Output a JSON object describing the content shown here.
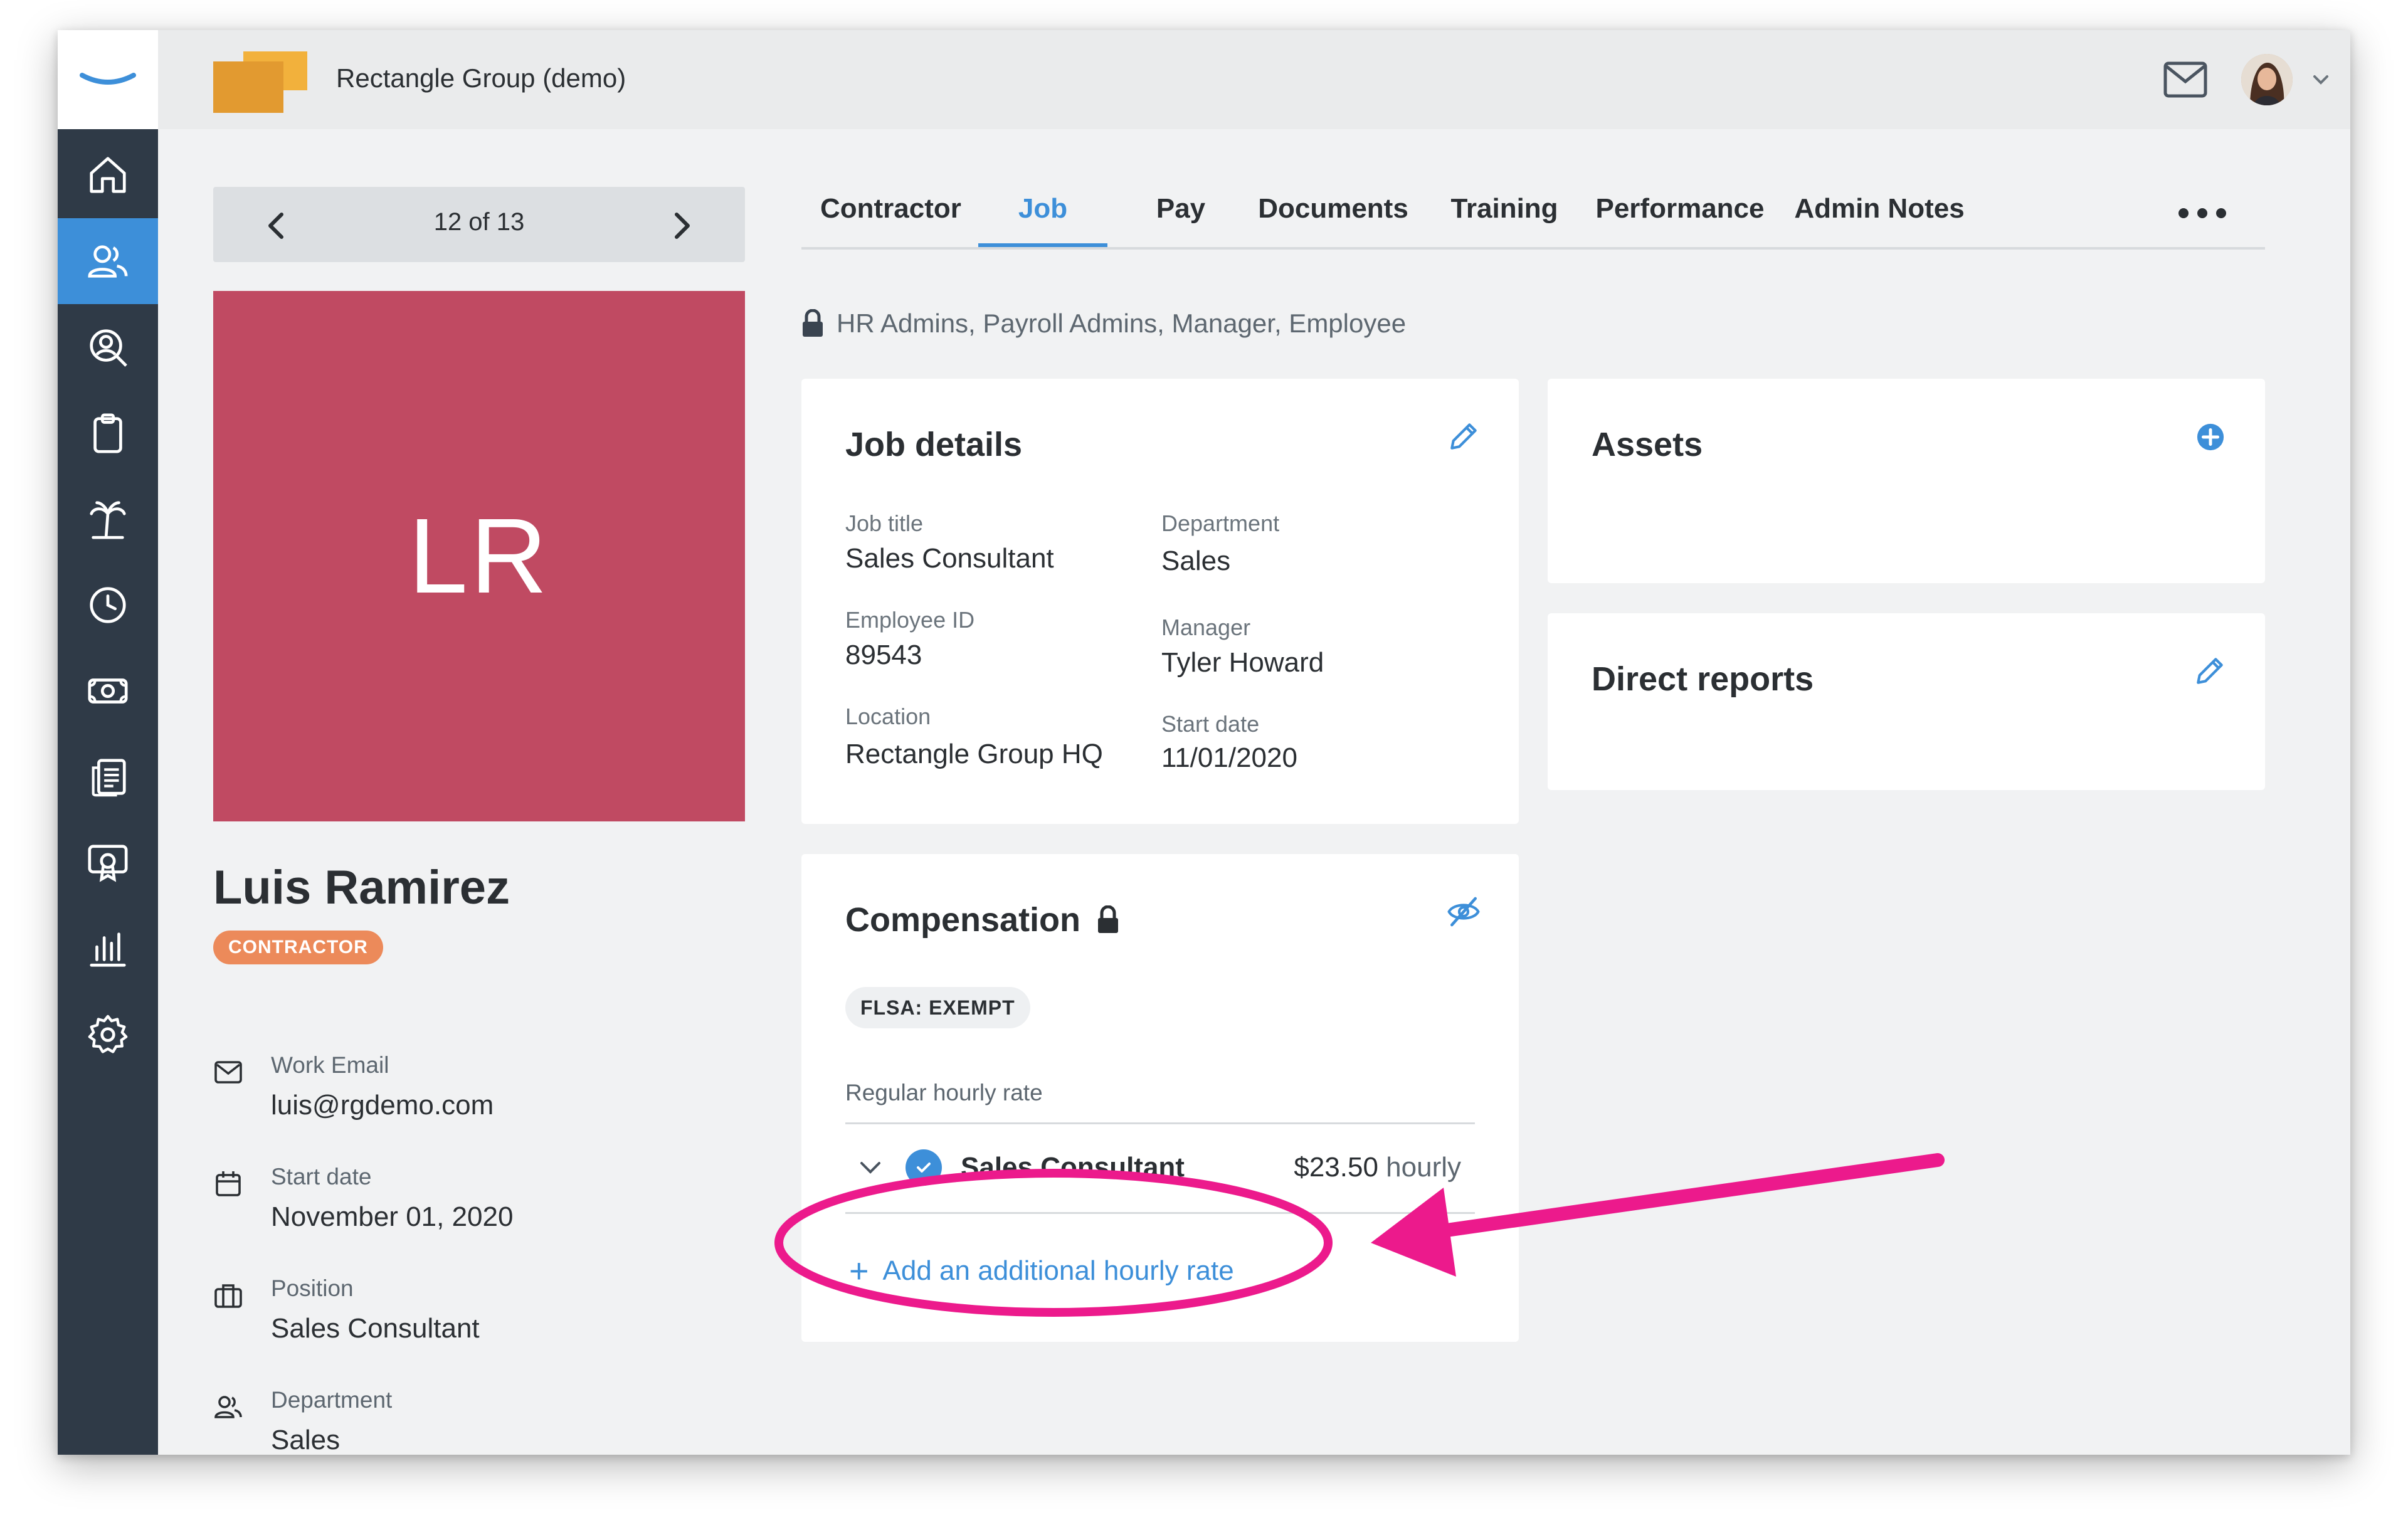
{
  "topbar": {
    "company_name": "Rectangle Group (demo)",
    "mail_icon": "mail-icon",
    "avatar_icon": "user-avatar"
  },
  "sidebar": {
    "items": [
      {
        "icon": "home-icon",
        "active": false
      },
      {
        "icon": "people-icon",
        "active": true
      },
      {
        "icon": "person-search-icon",
        "active": false
      },
      {
        "icon": "clipboard-icon",
        "active": false
      },
      {
        "icon": "palm-tree-icon",
        "active": false
      },
      {
        "icon": "clock-icon",
        "active": false
      },
      {
        "icon": "money-icon",
        "active": false
      },
      {
        "icon": "documents-icon",
        "active": false
      },
      {
        "icon": "certificate-icon",
        "active": false
      },
      {
        "icon": "bar-chart-icon",
        "active": false
      },
      {
        "icon": "gear-icon",
        "active": false
      }
    ]
  },
  "profile": {
    "pager": "12 of 13",
    "initials": "LR",
    "name": "Luis Ramirez",
    "badge": "CONTRACTOR",
    "photo_color": "#c04a62",
    "info": [
      {
        "icon": "mail-icon",
        "label": "Work Email",
        "value": "luis@rgdemo.com"
      },
      {
        "icon": "calendar-icon",
        "label": "Start date",
        "value": "November 01, 2020"
      },
      {
        "icon": "briefcase-icon",
        "label": "Position",
        "value": "Sales Consultant"
      },
      {
        "icon": "people-icon",
        "label": "Department",
        "value": "Sales"
      }
    ]
  },
  "tabs": [
    {
      "label": "Contractor",
      "active": false
    },
    {
      "label": "Job",
      "active": true
    },
    {
      "label": "Pay",
      "active": false
    },
    {
      "label": "Documents",
      "active": false
    },
    {
      "label": "Training",
      "active": false
    },
    {
      "label": "Performance",
      "active": false
    },
    {
      "label": "Admin Notes",
      "active": false
    }
  ],
  "access": "HR Admins, Payroll Admins, Manager, Employee",
  "job_details": {
    "title": "Job details",
    "fields": [
      {
        "label": "Job title",
        "value": "Sales Consultant"
      },
      {
        "label": "Department",
        "value": "Sales"
      },
      {
        "label": "Employee ID",
        "value": "89543"
      },
      {
        "label": "Manager",
        "value": "Tyler Howard"
      },
      {
        "label": "Location",
        "value": "Rectangle Group HQ"
      },
      {
        "label": "Start date",
        "value": "11/01/2020"
      }
    ]
  },
  "assets": {
    "title": "Assets"
  },
  "direct_reports": {
    "title": "Direct reports"
  },
  "compensation": {
    "title": "Compensation",
    "flsa": "FLSA: EXEMPT",
    "rate_heading": "Regular hourly rate",
    "rate_title": "Sales Consultant",
    "rate_amount": "$23.50",
    "rate_unit": "hourly",
    "add_rate": "Add an additional hourly rate"
  },
  "colors": {
    "accent": "#3d8fd9",
    "sidebar": "#2f3a47",
    "badge": "#ec8a5a",
    "annotation": "#ec1a8c"
  }
}
